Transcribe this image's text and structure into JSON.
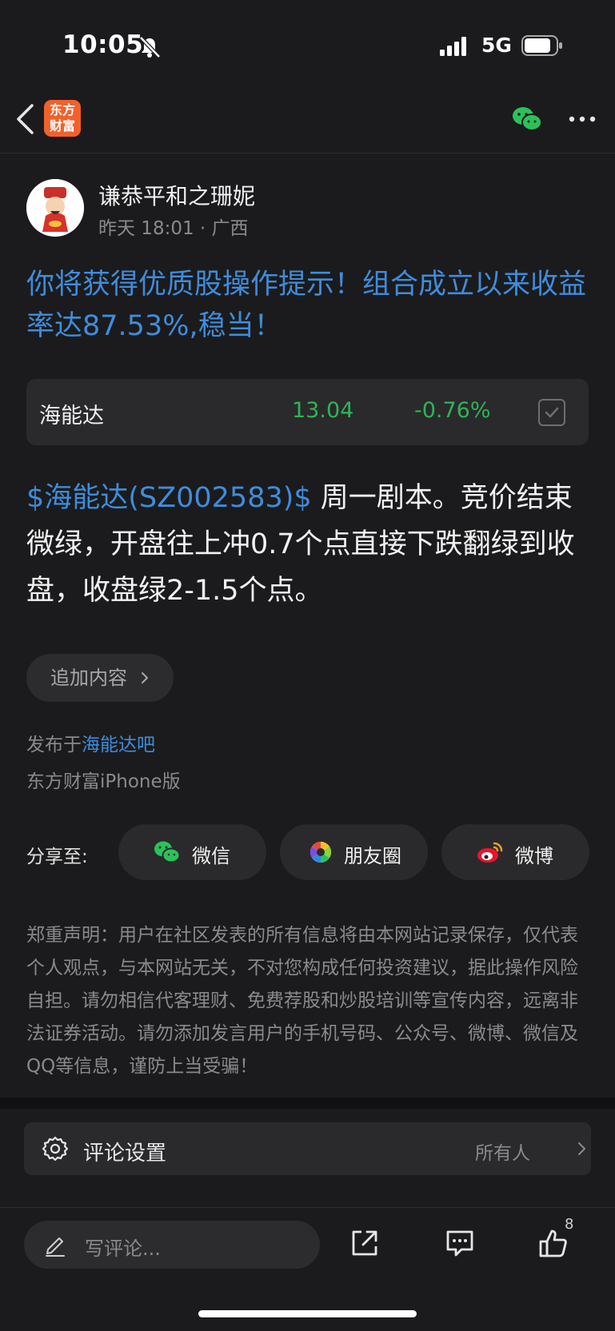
{
  "status_bar": {
    "time": "10:05",
    "network": "5G"
  },
  "nav": {
    "logo_text_line1": "东方",
    "logo_text_line2": "财富"
  },
  "author": {
    "name": "谦恭平和之珊妮",
    "meta": "昨天 18:01 · 广西"
  },
  "post": {
    "title": "你将获得优质股操作提示！组合成立以来收益率达87.53%,稳当！",
    "body_tag": "$海能达(SZ002583)$",
    "body_text": "  周一剧本。竞价结束微绿，开盘往上冲0.7个点直接下跌翻绿到收盘，收盘绿2-1.5个点。"
  },
  "stock_card": {
    "name": "海能达",
    "price": "13.04",
    "change": "-0.76%"
  },
  "append_button": "追加内容",
  "publish": {
    "prefix": "发布于",
    "bar_name": "海能达吧",
    "device": "东方财富iPhone版"
  },
  "share": {
    "label": "分享至:",
    "wechat": "微信",
    "moments": "朋友圈",
    "weibo": "微博"
  },
  "disclaimer": "郑重声明：用户在社区发表的所有信息将由本网站记录保存，仅代表个人观点，与本网站无关，不对您构成任何投资建议，据此操作风险自担。请勿相信代客理财、免费荐股和炒股培训等宣传内容，远离非法证券活动。请勿添加发言用户的手机号码、公众号、微博、微信及QQ等信息，谨防上当受骗！",
  "comment_settings": {
    "label": "评论设置",
    "value": "所有人"
  },
  "toolbar": {
    "placeholder": "写评论...",
    "like_count": "8"
  },
  "colors": {
    "link_blue": "#3f8cdb",
    "down_green": "#2fb457",
    "brand_orange": "#f2612a",
    "wechat_green": "#2dc15a"
  }
}
